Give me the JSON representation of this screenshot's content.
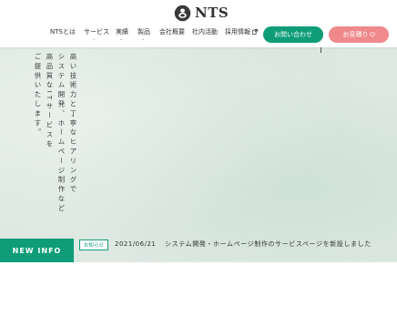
{
  "header": {
    "logo_text": "NTS",
    "nav": [
      {
        "label": "NTSとは",
        "has_submenu": false
      },
      {
        "label": "サービス",
        "has_submenu": true
      },
      {
        "label": "実績",
        "has_submenu": true
      },
      {
        "label": "製品",
        "has_submenu": true
      },
      {
        "label": "会社概要",
        "has_submenu": false
      },
      {
        "label": "社内活動",
        "has_submenu": false
      },
      {
        "label": "採用情報",
        "has_submenu": false,
        "external": true
      }
    ],
    "submenu_marker": "⌄",
    "contact_label": "お問い合わせ",
    "estimate_label": "お見積り"
  },
  "hero": {
    "copy_lines": [
      "高い技術力と丁寧なヒアリングで",
      "システム開発、ホームページ制作など",
      "高品質なITサービスを",
      "ご提供いたします。"
    ]
  },
  "news": {
    "section_label": "NEW INFO",
    "badge": "お知らせ",
    "date": "2021/06/21",
    "title": "システム開発・ホームページ制作のサービスページを新設しました"
  },
  "colors": {
    "brand_green": "#0e9d78",
    "accent_pink": "#f0898b",
    "hero_background": "#dde9e2"
  }
}
